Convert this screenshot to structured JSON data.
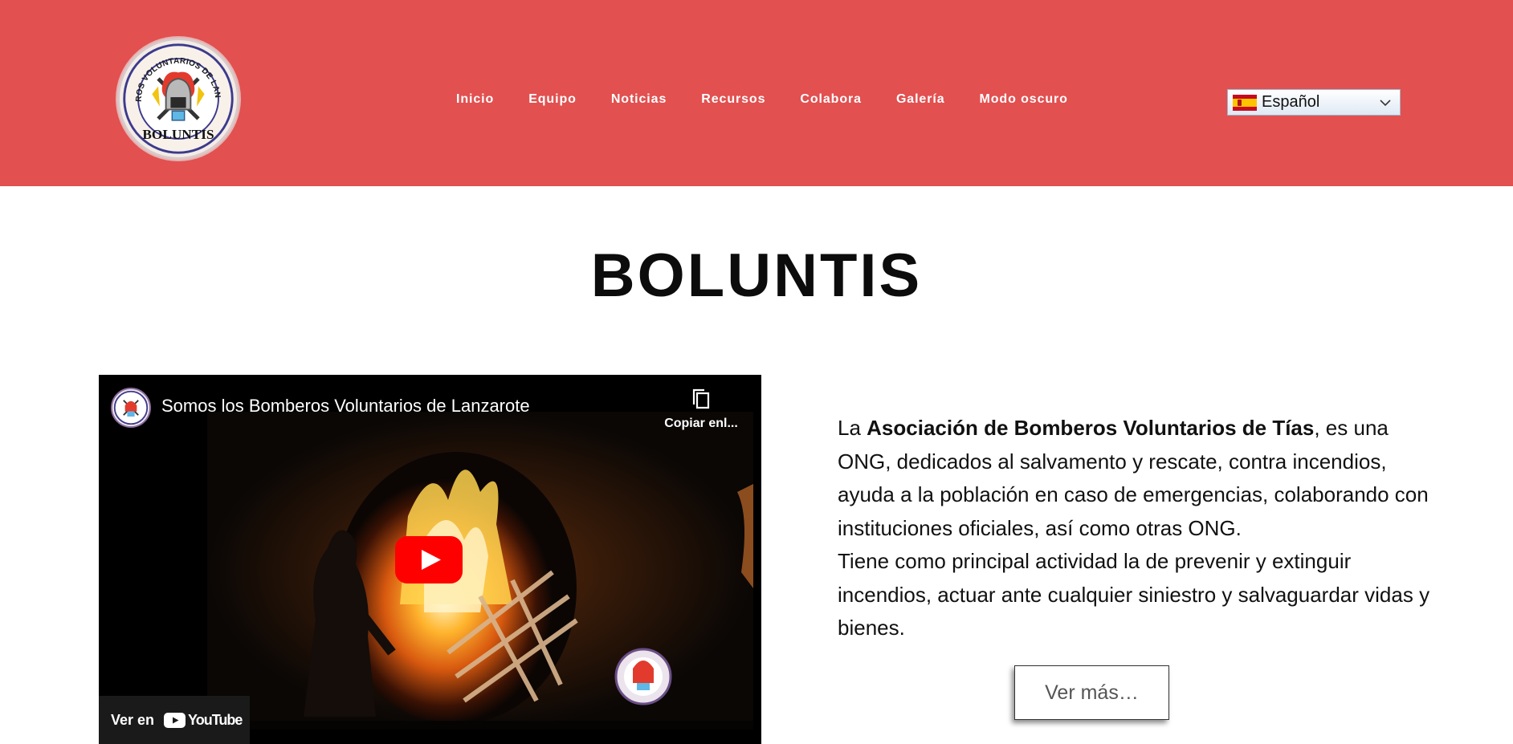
{
  "header": {
    "logo": {
      "icon": "boluntis-logo-icon",
      "arc_text": "BOMBEROS VOLUNTARIOS DE LANZAROTE",
      "bottom_text": "BOLUNTIS"
    },
    "nav": [
      {
        "label": "Inicio"
      },
      {
        "label": "Equipo"
      },
      {
        "label": "Noticias"
      },
      {
        "label": "Recursos"
      },
      {
        "label": "Colabora"
      },
      {
        "label": "Galería"
      },
      {
        "label": "Modo oscuro"
      }
    ],
    "language": {
      "selected": "Español",
      "flag": "spain-flag-icon"
    }
  },
  "main": {
    "title": "BOLUNTIS",
    "video": {
      "title": "Somos los Bomberos Voluntarios de Lanzarote",
      "copy_label": "Copiar enl...",
      "watch_on_label": "Ver en",
      "youtube_label": "YouTube"
    },
    "description": {
      "p1_before": "La ",
      "p1_bold": "Asociación de Bomberos Voluntarios de Tías",
      "p1_after": ", es una ONG, dedicados al salvamento y rescate, contra incendios, ayuda a la población en caso de emergencias, colaborando con instituciones oficiales, así como otras ONG.",
      "p2": "Tiene como principal actividad la de prevenir y extinguir incendios, actuar ante cualquier siniestro y salvaguardar vidas y bienes."
    },
    "cta_label": "Ver más…"
  },
  "colors": {
    "header_bg": "#e25050",
    "youtube_red": "#ff0000",
    "text": "#111111"
  }
}
